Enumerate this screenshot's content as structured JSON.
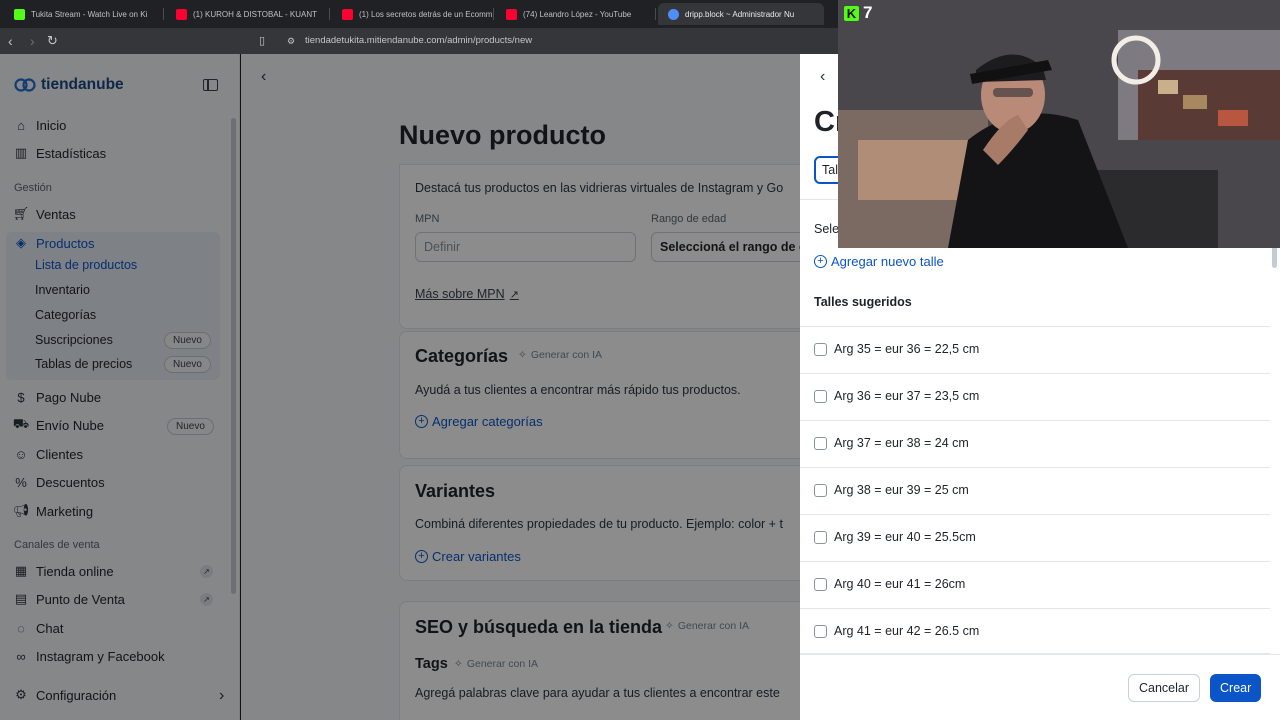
{
  "browser": {
    "tabs": [
      {
        "title": "Tukita Stream - Watch Live on Ki",
        "fav_color": "#53fc18"
      },
      {
        "title": "(1) KUROH & DISTOBAL - KUANT",
        "fav_color": "#ff0033"
      },
      {
        "title": "(1) Los secretos detrás de un Ecomm",
        "fav_color": "#ff0033"
      },
      {
        "title": "(74) Leandro López - YouTube",
        "fav_color": "#ff0033"
      },
      {
        "title": "dripp.block ~ Administrador Nu",
        "fav_color": "#4f8ef7"
      }
    ],
    "url": "tiendadetukita.mitiendanube.com/admin/products/new"
  },
  "sidebar": {
    "brand": "tiendanube",
    "items": {
      "inicio": "Inicio",
      "estadisticas": "Estadísticas",
      "section_gestion": "Gestión",
      "ventas": "Ventas",
      "productos": "Productos",
      "lista": "Lista de productos",
      "inventario": "Inventario",
      "categorias": "Categorías",
      "suscripciones": "Suscripciones",
      "tablas": "Tablas de precios",
      "pago_nube": "Pago Nube",
      "envio_nube": "Envío Nube",
      "clientes": "Clientes",
      "descuentos": "Descuentos",
      "marketing": "Marketing",
      "section_canales": "Canales de venta",
      "tienda_online": "Tienda online",
      "punto_venta": "Punto de Venta",
      "chat": "Chat",
      "instagram": "Instagram y Facebook",
      "configuracion": "Configuración"
    },
    "badge_nuevo": "Nuevo"
  },
  "main": {
    "title": "Nuevo producto",
    "google_card": {
      "intro": "Destacá tus productos en las vidrieras virtuales de Instagram y Go",
      "mpn_label": "MPN",
      "mpn_placeholder": "Definir",
      "age_label": "Rango de edad",
      "age_value": "Seleccioná el rango de e",
      "mpn_link": "Más sobre MPN"
    },
    "categorias": {
      "title": "Categorías",
      "ai": "Generar con IA",
      "desc": "Ayudá a tus clientes a encontrar más rápido tus productos.",
      "link": "Agregar categorías"
    },
    "variantes": {
      "title": "Variantes",
      "desc": "Combiná diferentes propiedades de tu producto. Ejemplo: color + t",
      "link": "Crear variantes"
    },
    "seo": {
      "title": "SEO y búsqueda en la tienda",
      "ai": "Generar con IA",
      "tags_title": "Tags",
      "tags_ai": "Generar con IA",
      "tags_desc": "Agregá palabras clave para ayudar a tus clientes a encontrar este"
    }
  },
  "drawer": {
    "title": "Cr",
    "input_value": "Tal",
    "select_label": "Sele",
    "add_size": "Agregar nuevo talle",
    "suggested_title": "Talles sugeridos",
    "sizes": [
      "Arg 35 = eur 36 = 22,5 cm",
      "Arg 36 = eur 37 = 23,5 cm",
      "Arg 37 = eur 38 = 24 cm",
      "Arg 38 = eur 39 = 25 cm",
      "Arg 39 = eur 40 = 25.5cm",
      "Arg 40 = eur 41 = 26cm",
      "Arg 41 = eur 42 = 26.5 cm"
    ],
    "cancel": "Cancelar",
    "create": "Crear"
  },
  "webcam": {
    "viewer_count": "7"
  }
}
